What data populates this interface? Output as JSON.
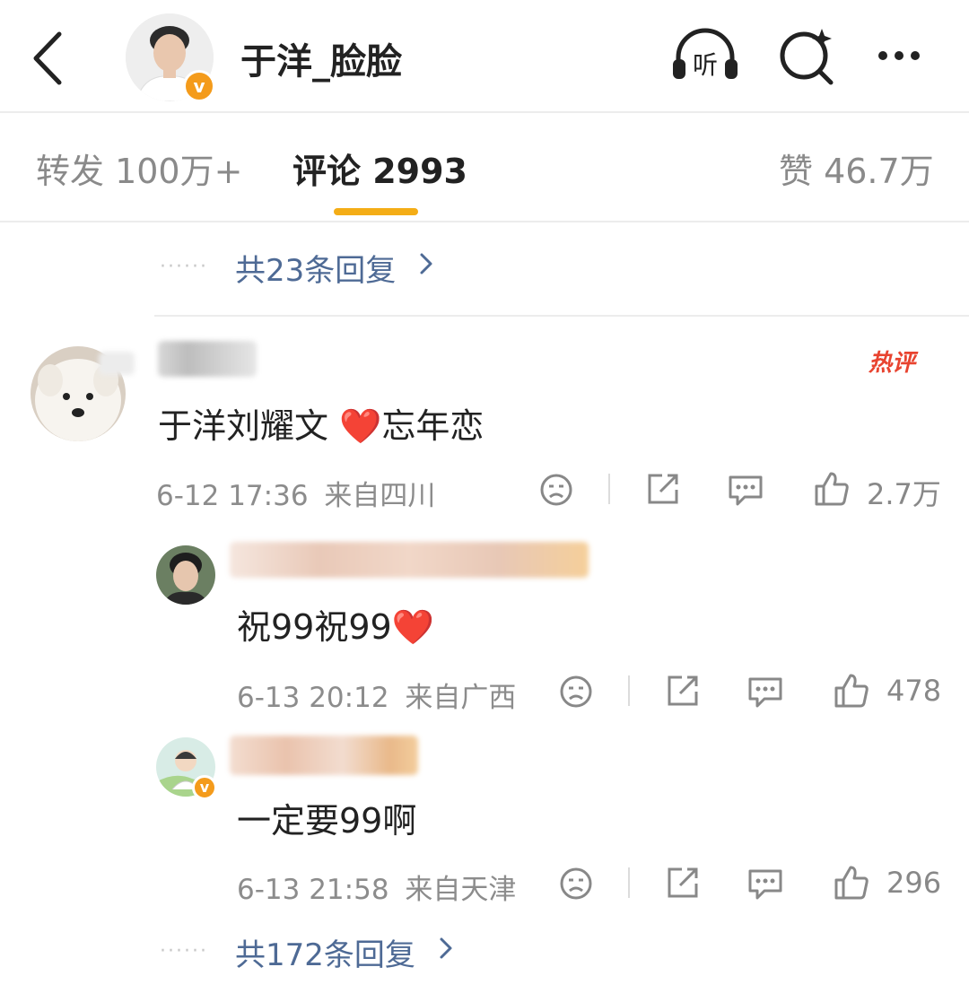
{
  "header": {
    "title": "于洋_脸脸",
    "back_icon": "back-arrow-icon",
    "listen_icon": "headphones-icon",
    "listen_label": "听",
    "search_icon": "search-icon",
    "more_icon": "more-icon",
    "verified_mark": "v"
  },
  "tabs": {
    "repost": "转发 100万+",
    "comments": "评论 2993",
    "likes": "赞 46.7万",
    "active": "comments",
    "accent": "#f4ad16"
  },
  "top_more": {
    "dots": "······",
    "label": "共23条回复"
  },
  "comment": {
    "badge": "热评",
    "text": "于洋刘耀文 ",
    "text_heart": "❤️",
    "text_tail": "忘年恋",
    "time": "6-12 17:36",
    "location": "来自四川",
    "likes": "2.7万"
  },
  "replies": [
    {
      "text": "祝99祝99",
      "heart": "❤️",
      "time": "6-13 20:12",
      "location": "来自广西",
      "likes": "478"
    },
    {
      "text": "一定要99啊",
      "time": "6-13 21:58",
      "location": "来自天津",
      "likes": "296",
      "verified_mark": "v"
    }
  ],
  "bottom_more": {
    "dots": "······",
    "label": "共172条回复"
  },
  "colors": {
    "link": "#4e6a95",
    "hot": "#e8432f",
    "verified": "#f49b1b"
  }
}
